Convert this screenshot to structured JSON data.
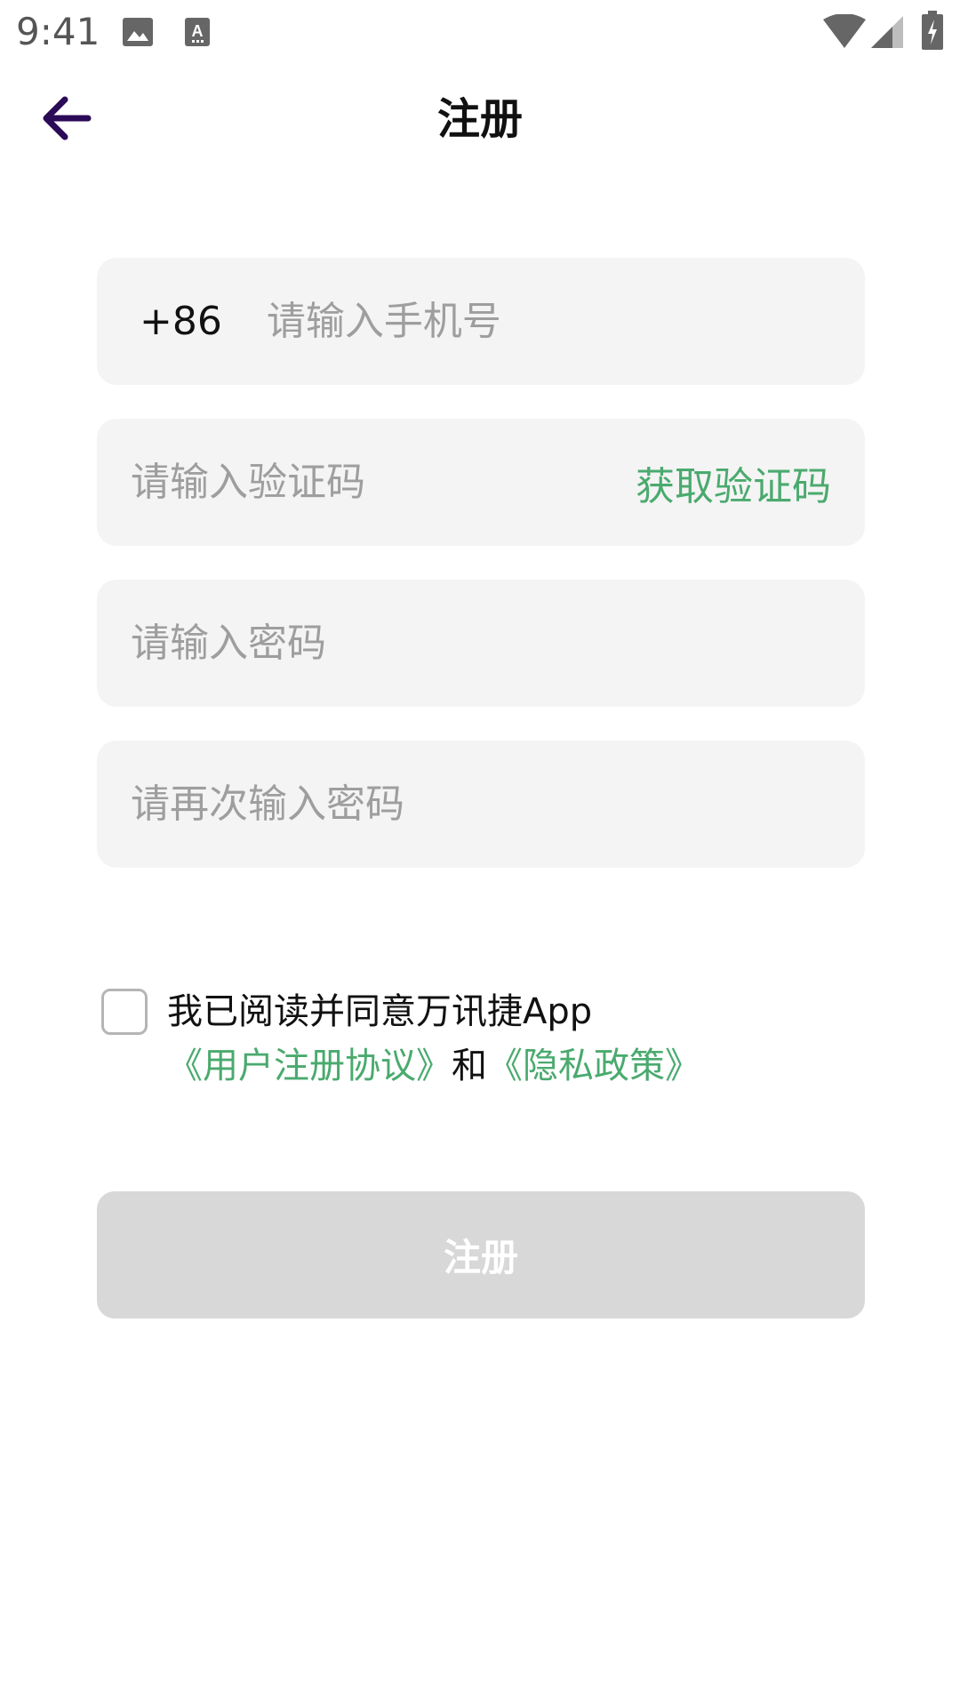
{
  "status_bar": {
    "time": "9:41",
    "icons": [
      "image-icon",
      "keyboard-a-icon",
      "wifi-icon",
      "signal-icon",
      "battery-charging-icon"
    ]
  },
  "header": {
    "title": "注册",
    "back_icon": "arrow-left-icon"
  },
  "form": {
    "country_code": "+86",
    "phone_placeholder": "请输入手机号",
    "code_placeholder": "请输入验证码",
    "get_code_label": "获取验证码",
    "password_placeholder": "请输入密码",
    "confirm_password_placeholder": "请再次输入密码"
  },
  "agreement": {
    "checked": false,
    "text_prefix": "我已阅读并同意万讯捷App",
    "user_agreement_link": "《用户注册协议》",
    "conjunction": "和",
    "privacy_policy_link": "《隐私政策》"
  },
  "submit": {
    "label": "注册"
  },
  "colors": {
    "accent_green": "#4aaa6e",
    "field_bg": "#f4f4f4",
    "button_disabled_bg": "#d8d8d8",
    "back_arrow": "#2b0a57"
  }
}
